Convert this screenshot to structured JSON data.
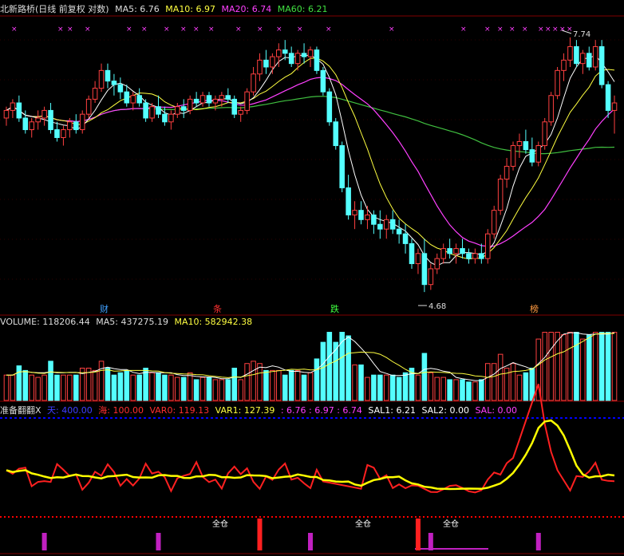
{
  "header": {
    "title": "北新路桥(日线 前复权 对数)",
    "ma5": "MA5: 6.76",
    "ma10": "MA10: 6.97",
    "ma20": "MA20: 6.74",
    "ma60": "MA60: 6.21"
  },
  "volume_header": {
    "volume": "VOLUME: 118206.44",
    "ma5": "MA5: 437275.19",
    "ma10": "MA10: 582942.38"
  },
  "indicator_header": {
    "name": "准备翻翻X",
    "sky": "天: 400.00",
    "sea": "海: 100.00",
    "var0": "VAR0: 119.13",
    "var1": "VAR1: 127.39",
    "vals": ": 6.76 : 6.97 : 6.74",
    "sal1": "SAL1: 6.21",
    "sal2": "SAL2: 0.00",
    "sal": "SAL: 0.00"
  },
  "price_labels": {
    "high": "7.74",
    "low": "4.68"
  },
  "event_labels": [
    "财",
    "条",
    "跌",
    "榜"
  ],
  "signal_labels": [
    "全仓",
    "全仓",
    "全仓"
  ],
  "colors": {
    "up": "#ff4040",
    "down": "#54ffff",
    "ma5": "#ffffff",
    "ma10": "#ffff40",
    "ma20": "#ff40ff",
    "ma60": "#40c040",
    "var0": "#ff2020",
    "var1": "#ffff00",
    "grid": "#800000",
    "dotline": "#0000ff",
    "reddot": "#ff0000",
    "bar_mag": "#c020c0",
    "bar_red": "#ff2020"
  },
  "chart_data": {
    "type": "candlestick",
    "candles": [
      [
        6.6,
        6.75,
        6.5,
        6.7
      ],
      [
        6.7,
        6.85,
        6.6,
        6.8
      ],
      [
        6.8,
        6.9,
        6.55,
        6.6
      ],
      [
        6.6,
        6.7,
        6.4,
        6.45
      ],
      [
        6.45,
        6.6,
        6.35,
        6.55
      ],
      [
        6.55,
        6.7,
        6.45,
        6.6
      ],
      [
        6.6,
        6.75,
        6.5,
        6.7
      ],
      [
        6.7,
        6.8,
        6.4,
        6.45
      ],
      [
        6.45,
        6.55,
        6.3,
        6.35
      ],
      [
        6.35,
        6.5,
        6.25,
        6.45
      ],
      [
        6.45,
        6.6,
        6.35,
        6.55
      ],
      [
        6.55,
        6.65,
        6.4,
        6.45
      ],
      [
        6.45,
        6.7,
        6.4,
        6.65
      ],
      [
        6.65,
        6.9,
        6.6,
        6.85
      ],
      [
        6.85,
        7.1,
        6.8,
        7.0
      ],
      [
        7.0,
        7.35,
        6.95,
        7.25
      ],
      [
        7.25,
        7.35,
        7.0,
        7.1
      ],
      [
        7.1,
        7.2,
        6.9,
        7.05
      ],
      [
        7.05,
        7.15,
        6.85,
        6.95
      ],
      [
        6.95,
        7.05,
        6.75,
        6.8
      ],
      [
        6.8,
        6.95,
        6.7,
        6.9
      ],
      [
        6.9,
        7.0,
        6.75,
        6.8
      ],
      [
        6.8,
        6.85,
        6.55,
        6.6
      ],
      [
        6.6,
        6.8,
        6.55,
        6.75
      ],
      [
        6.75,
        6.9,
        6.6,
        6.65
      ],
      [
        6.65,
        6.75,
        6.5,
        6.55
      ],
      [
        6.55,
        6.7,
        6.45,
        6.65
      ],
      [
        6.65,
        6.8,
        6.6,
        6.75
      ],
      [
        6.75,
        6.85,
        6.6,
        6.7
      ],
      [
        6.7,
        6.9,
        6.65,
        6.85
      ],
      [
        6.85,
        6.95,
        6.75,
        6.8
      ],
      [
        6.8,
        6.95,
        6.75,
        6.9
      ],
      [
        6.9,
        6.95,
        6.75,
        6.8
      ],
      [
        6.8,
        6.9,
        6.7,
        6.85
      ],
      [
        6.85,
        6.95,
        6.75,
        6.9
      ],
      [
        6.9,
        7.0,
        6.8,
        6.85
      ],
      [
        6.85,
        6.9,
        6.6,
        6.65
      ],
      [
        6.65,
        6.75,
        6.55,
        6.7
      ],
      [
        6.7,
        7.0,
        6.65,
        6.95
      ],
      [
        6.95,
        7.3,
        6.9,
        7.2
      ],
      [
        7.2,
        7.5,
        7.1,
        7.4
      ],
      [
        7.4,
        7.55,
        7.2,
        7.3
      ],
      [
        7.3,
        7.5,
        7.2,
        7.45
      ],
      [
        7.45,
        7.65,
        7.3,
        7.55
      ],
      [
        7.55,
        7.7,
        7.4,
        7.5
      ],
      [
        7.5,
        7.6,
        7.3,
        7.35
      ],
      [
        7.35,
        7.55,
        7.25,
        7.5
      ],
      [
        7.5,
        7.65,
        7.35,
        7.45
      ],
      [
        7.45,
        7.6,
        7.3,
        7.55
      ],
      [
        7.55,
        7.6,
        7.2,
        7.25
      ],
      [
        7.25,
        7.3,
        6.9,
        6.95
      ],
      [
        6.95,
        7.0,
        6.5,
        6.55
      ],
      [
        6.55,
        6.6,
        6.2,
        6.25
      ],
      [
        6.25,
        6.3,
        5.7,
        5.75
      ],
      [
        5.75,
        5.9,
        5.4,
        5.45
      ],
      [
        5.45,
        5.6,
        5.3,
        5.5
      ],
      [
        5.5,
        5.6,
        5.35,
        5.4
      ],
      [
        5.4,
        5.55,
        5.3,
        5.45
      ],
      [
        5.45,
        5.5,
        5.25,
        5.35
      ],
      [
        5.35,
        5.5,
        5.2,
        5.3
      ],
      [
        5.3,
        5.45,
        5.2,
        5.4
      ],
      [
        5.4,
        5.5,
        5.25,
        5.3
      ],
      [
        5.3,
        5.4,
        5.15,
        5.25
      ],
      [
        5.25,
        5.35,
        5.05,
        5.15
      ],
      [
        5.15,
        5.2,
        4.9,
        4.95
      ],
      [
        4.95,
        5.1,
        4.85,
        5.05
      ],
      [
        5.05,
        5.2,
        4.68,
        4.75
      ],
      [
        4.75,
        4.95,
        4.7,
        4.9
      ],
      [
        4.9,
        5.05,
        4.85,
        5.0
      ],
      [
        5.0,
        5.15,
        4.95,
        5.1
      ],
      [
        5.1,
        5.2,
        5.0,
        5.05
      ],
      [
        5.05,
        5.15,
        4.95,
        5.1
      ],
      [
        5.1,
        5.2,
        5.0,
        5.05
      ],
      [
        5.05,
        5.1,
        4.95,
        5.0
      ],
      [
        5.0,
        5.1,
        4.95,
        5.05
      ],
      [
        5.05,
        5.15,
        4.95,
        5.0
      ],
      [
        5.0,
        5.3,
        4.95,
        5.25
      ],
      [
        5.25,
        5.55,
        5.2,
        5.5
      ],
      [
        5.5,
        5.9,
        5.45,
        5.85
      ],
      [
        5.85,
        6.1,
        5.75,
        6.0
      ],
      [
        6.0,
        6.3,
        5.95,
        6.25
      ],
      [
        6.25,
        6.4,
        6.1,
        6.3
      ],
      [
        6.3,
        6.45,
        6.15,
        6.2
      ],
      [
        6.2,
        6.35,
        6.0,
        6.05
      ],
      [
        6.05,
        6.3,
        6.0,
        6.25
      ],
      [
        6.25,
        6.6,
        6.2,
        6.55
      ],
      [
        6.55,
        6.95,
        6.5,
        6.9
      ],
      [
        6.9,
        7.3,
        6.85,
        7.25
      ],
      [
        7.25,
        7.5,
        7.1,
        7.4
      ],
      [
        7.4,
        7.74,
        7.3,
        7.6
      ],
      [
        7.6,
        7.7,
        7.3,
        7.35
      ],
      [
        7.35,
        7.55,
        7.2,
        7.5
      ],
      [
        7.5,
        7.6,
        7.25,
        7.3
      ],
      [
        7.3,
        7.7,
        7.25,
        7.6
      ],
      [
        7.6,
        7.7,
        7.0,
        7.05
      ],
      [
        7.05,
        7.1,
        6.6,
        6.7
      ],
      [
        6.7,
        6.9,
        6.4,
        6.8
      ]
    ],
    "price_range": [
      4.55,
      8.1
    ],
    "volume_max": 1400000,
    "indicator_range": [
      0,
      220
    ]
  }
}
